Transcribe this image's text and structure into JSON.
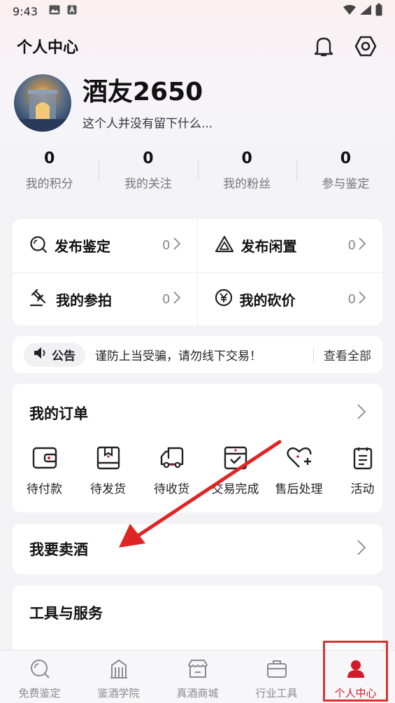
{
  "status_bar": {
    "time": "9:43"
  },
  "header": {
    "title": "个人中心",
    "bell_icon": "bell-icon",
    "settings_icon": "gear-icon"
  },
  "profile": {
    "name": "酒友2650",
    "bio": "这个人并没有留下什么..."
  },
  "stats": [
    {
      "value": "0",
      "label": "我的积分"
    },
    {
      "value": "0",
      "label": "我的关注"
    },
    {
      "value": "0",
      "label": "我的粉丝"
    },
    {
      "value": "0",
      "label": "参与鉴定"
    }
  ],
  "quick_actions": [
    {
      "label": "发布鉴定",
      "count": "0",
      "icon": "search-icon"
    },
    {
      "label": "发布闲置",
      "count": "0",
      "icon": "triangle-recycle-icon"
    },
    {
      "label": "我的参拍",
      "count": "0",
      "icon": "auction-hammer-icon"
    },
    {
      "label": "我的砍价",
      "count": "0",
      "icon": "yen-icon"
    }
  ],
  "notice": {
    "tag": "公告",
    "text": "谨防上当受骗，请勿线下交易！",
    "view_all": "查看全部"
  },
  "orders": {
    "title": "我的订单",
    "items": [
      {
        "label": "待付款",
        "icon": "wallet-icon"
      },
      {
        "label": "待发货",
        "icon": "box-icon"
      },
      {
        "label": "待收货",
        "icon": "truck-icon"
      },
      {
        "label": "交易完成",
        "icon": "box-check-icon"
      },
      {
        "label": "售后处理",
        "icon": "heart-plus-icon"
      },
      {
        "label": "活动",
        "icon": "document-icon"
      }
    ]
  },
  "sell": {
    "label": "我要卖酒"
  },
  "tools": {
    "title": "工具与服务"
  },
  "tabbar": [
    {
      "label": "免费鉴定",
      "icon": "search-icon"
    },
    {
      "label": "鉴酒学院",
      "icon": "building-icon"
    },
    {
      "label": "真酒商城",
      "icon": "store-icon"
    },
    {
      "label": "行业工具",
      "icon": "briefcase-icon"
    },
    {
      "label": "个人中心",
      "icon": "user-icon",
      "active": true
    }
  ],
  "colors": {
    "accent": "#d4192a",
    "annotation": "#e02424"
  }
}
